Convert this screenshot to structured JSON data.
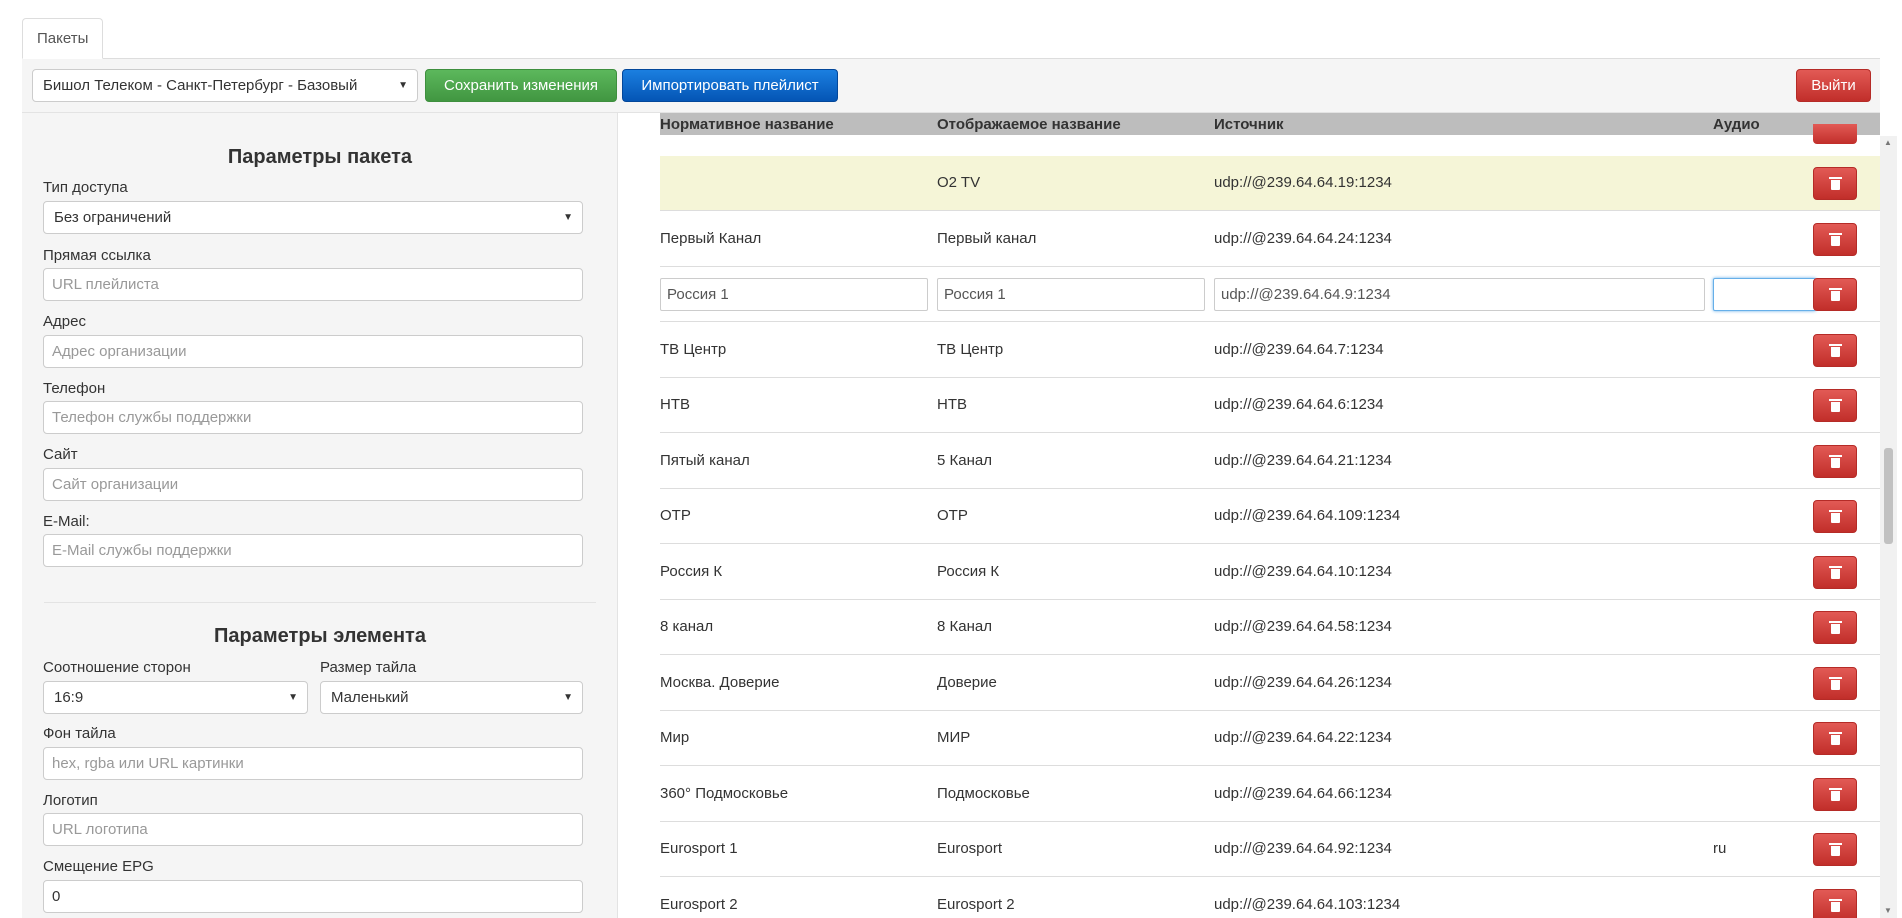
{
  "tabs": [
    {
      "label": "Пакеты"
    }
  ],
  "toolbar": {
    "package_select": "Бишол Телеком - Санкт-Петербург - Базовый",
    "save_label": "Сохранить изменения",
    "import_label": "Импортировать плейлист",
    "logout_label": "Выйти"
  },
  "colors": {
    "green": "#5cb85c",
    "blue": "#0a63c9",
    "red": "#d9534f",
    "highlight": "#f5f5d7",
    "header": "#bdbdbd"
  },
  "package_params": {
    "title": "Параметры пакета",
    "access_type": {
      "label": "Тип доступа",
      "value": "Без ограничений"
    },
    "direct_link": {
      "label": "Прямая ссылка",
      "placeholder": "URL плейлиста"
    },
    "address": {
      "label": "Адрес",
      "placeholder": "Адрес организации"
    },
    "phone": {
      "label": "Телефон",
      "placeholder": "Телефон службы поддержки"
    },
    "site": {
      "label": "Сайт",
      "placeholder": "Сайт организации"
    },
    "email": {
      "label": "E-Mail:",
      "placeholder": "E-Mail службы поддержки"
    }
  },
  "element_params": {
    "title": "Параметры элемента",
    "aspect_ratio": {
      "label": "Соотношение сторон",
      "value": "16:9"
    },
    "tile_size": {
      "label": "Размер тайла",
      "value": "Маленький"
    },
    "tile_bg": {
      "label": "Фон тайла",
      "placeholder": "hex, rgba или URL картинки"
    },
    "logo": {
      "label": "Логотип",
      "placeholder": "URL логотипа"
    },
    "epg_offset": {
      "label": "Смещение EPG",
      "value": "0"
    }
  },
  "table": {
    "headers": [
      "Нормативное название",
      "Отображаемое название",
      "Источник",
      "Аудио"
    ],
    "rows": [
      {
        "norm": "",
        "display": "O2 TV",
        "source": "udp://@239.64.64.19:1234",
        "audio": ""
      },
      {
        "norm": "Первый Канал",
        "display": "Первый канал",
        "source": "udp://@239.64.64.24:1234",
        "audio": ""
      },
      {
        "norm": "Россия 1",
        "display": "Россия 1",
        "source": "udp://@239.64.64.9:1234",
        "audio": ""
      },
      {
        "norm": "ТВ Центр",
        "display": "ТВ Центр",
        "source": "udp://@239.64.64.7:1234",
        "audio": ""
      },
      {
        "norm": "НТВ",
        "display": "НТВ",
        "source": "udp://@239.64.64.6:1234",
        "audio": ""
      },
      {
        "norm": "Пятый канал",
        "display": "5 Канал",
        "source": "udp://@239.64.64.21:1234",
        "audio": ""
      },
      {
        "norm": "ОТР",
        "display": "ОТР",
        "source": "udp://@239.64.64.109:1234",
        "audio": ""
      },
      {
        "norm": "Россия К",
        "display": "Россия К",
        "source": "udp://@239.64.64.10:1234",
        "audio": ""
      },
      {
        "norm": "8 канал",
        "display": "8 Канал",
        "source": "udp://@239.64.64.58:1234",
        "audio": ""
      },
      {
        "norm": "Москва. Доверие",
        "display": "Доверие",
        "source": "udp://@239.64.64.26:1234",
        "audio": ""
      },
      {
        "norm": "Мир",
        "display": "МИР",
        "source": "udp://@239.64.64.22:1234",
        "audio": ""
      },
      {
        "norm": "360° Подмосковье",
        "display": "Подмосковье",
        "source": "udp://@239.64.64.66:1234",
        "audio": ""
      },
      {
        "norm": "Eurosport 1",
        "display": "Eurosport",
        "source": "udp://@239.64.64.92:1234",
        "audio": "ru"
      },
      {
        "norm": "Eurosport 2",
        "display": "Eurosport 2",
        "source": "udp://@239.64.64.103:1234",
        "audio": ""
      }
    ]
  }
}
